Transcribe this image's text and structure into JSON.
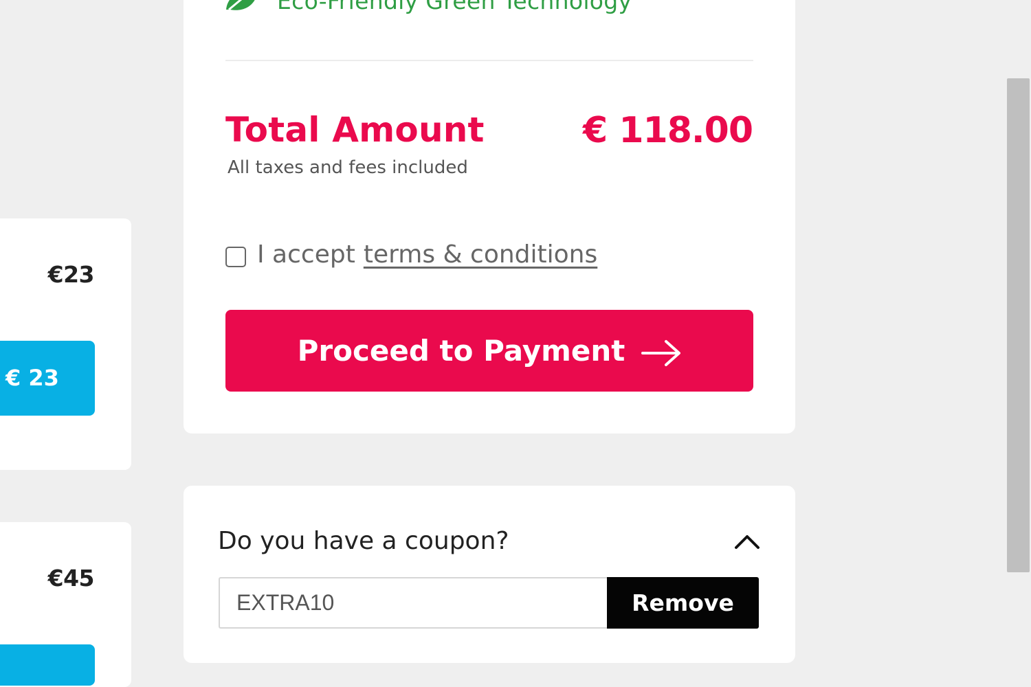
{
  "side_cards": [
    {
      "price": "€23",
      "button_label": "€ 23"
    },
    {
      "price": "€45",
      "button_label": ""
    }
  ],
  "summary": {
    "eco_label": "Eco-Friendly Green Technology",
    "total_label": "Total Amount",
    "total_value": "€ 118.00",
    "tax_note": "All taxes and fees included",
    "accept_prefix": "I accept",
    "terms_link": "terms & conditions",
    "terms_checked": false,
    "pay_button": "Proceed to Payment"
  },
  "coupon": {
    "title": "Do you have a coupon?",
    "code": "EXTRA10",
    "remove_label": "Remove"
  },
  "icons": {
    "leaf": "leaf-icon",
    "arrow": "arrow-right-icon",
    "chevron": "chevron-up-icon"
  },
  "colors": {
    "brand": "#ea0a4d",
    "eco_green": "#2f9e44",
    "side_button": "#08b0e4"
  }
}
